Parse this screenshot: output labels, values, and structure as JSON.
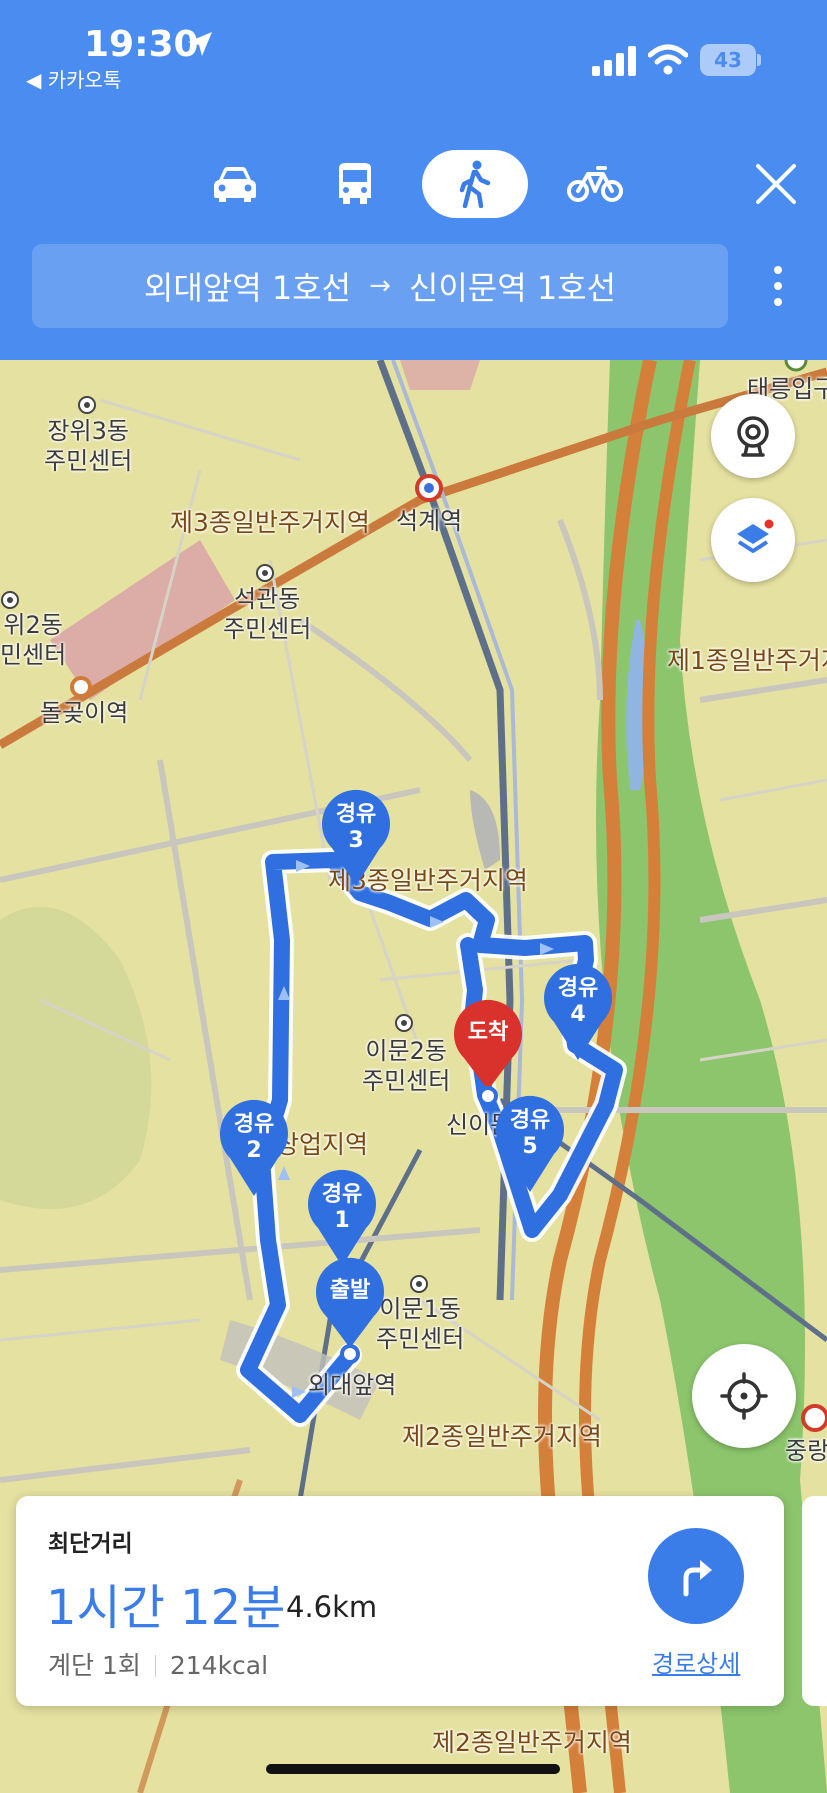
{
  "status_bar": {
    "time": "19:30",
    "back_app": "◀ 카카오톡",
    "battery": "43"
  },
  "modes": [
    {
      "name": "car",
      "icon": "car-icon",
      "active": false
    },
    {
      "name": "bus",
      "icon": "bus-icon",
      "active": false
    },
    {
      "name": "walk",
      "icon": "walk-icon",
      "active": true
    },
    {
      "name": "bike",
      "icon": "bike-icon",
      "active": false
    }
  ],
  "route": {
    "origin": "외대앞역 1호선",
    "arrow": "→",
    "destination": "신이문역 1호선"
  },
  "map": {
    "labels": {
      "jangwi3": "장위3동\n주민센터",
      "seokgwan": "석관동\n주민센터",
      "jangwi2": "위2동\n민센터",
      "dolgoji": "돌곶이역",
      "seokgye": "석계역",
      "taereung": "태릉입구",
      "zone3_top": "제3종일반주거지역",
      "zone3_mid": "제3종일반주거지역",
      "zone1": "제1종일반주거지",
      "imun2": "이문2동\n주민센터",
      "sinimun": "신이문",
      "commercial": "상업지역",
      "imun1": "이문1동\n주민센터",
      "oedae": "외대앞역",
      "zone2_a": "제2종일반주거지역",
      "zone2_b": "제2종일반주거지역",
      "jungnang": "중랑"
    },
    "pins": {
      "waypoint3": {
        "line1": "경유",
        "line2": "3"
      },
      "waypoint4": {
        "line1": "경유",
        "line2": "4"
      },
      "waypoint2": {
        "line1": "경유",
        "line2": "2"
      },
      "waypoint5": {
        "line1": "경유",
        "line2": "5"
      },
      "waypoint1": {
        "line1": "경유",
        "line2": "1"
      },
      "start": {
        "label": "출발"
      },
      "end": {
        "label": "도착"
      }
    }
  },
  "summary": {
    "label": "최단거리",
    "duration": "1시간 12분",
    "distance": "4.6km",
    "stairs": "계단 1회",
    "calories": "214kcal",
    "detail_link": "경로상세"
  },
  "colors": {
    "header": "#4a8cf0",
    "route": "#2f6fe0",
    "accent": "#3b7de8",
    "destination_pin": "#d9312b"
  }
}
